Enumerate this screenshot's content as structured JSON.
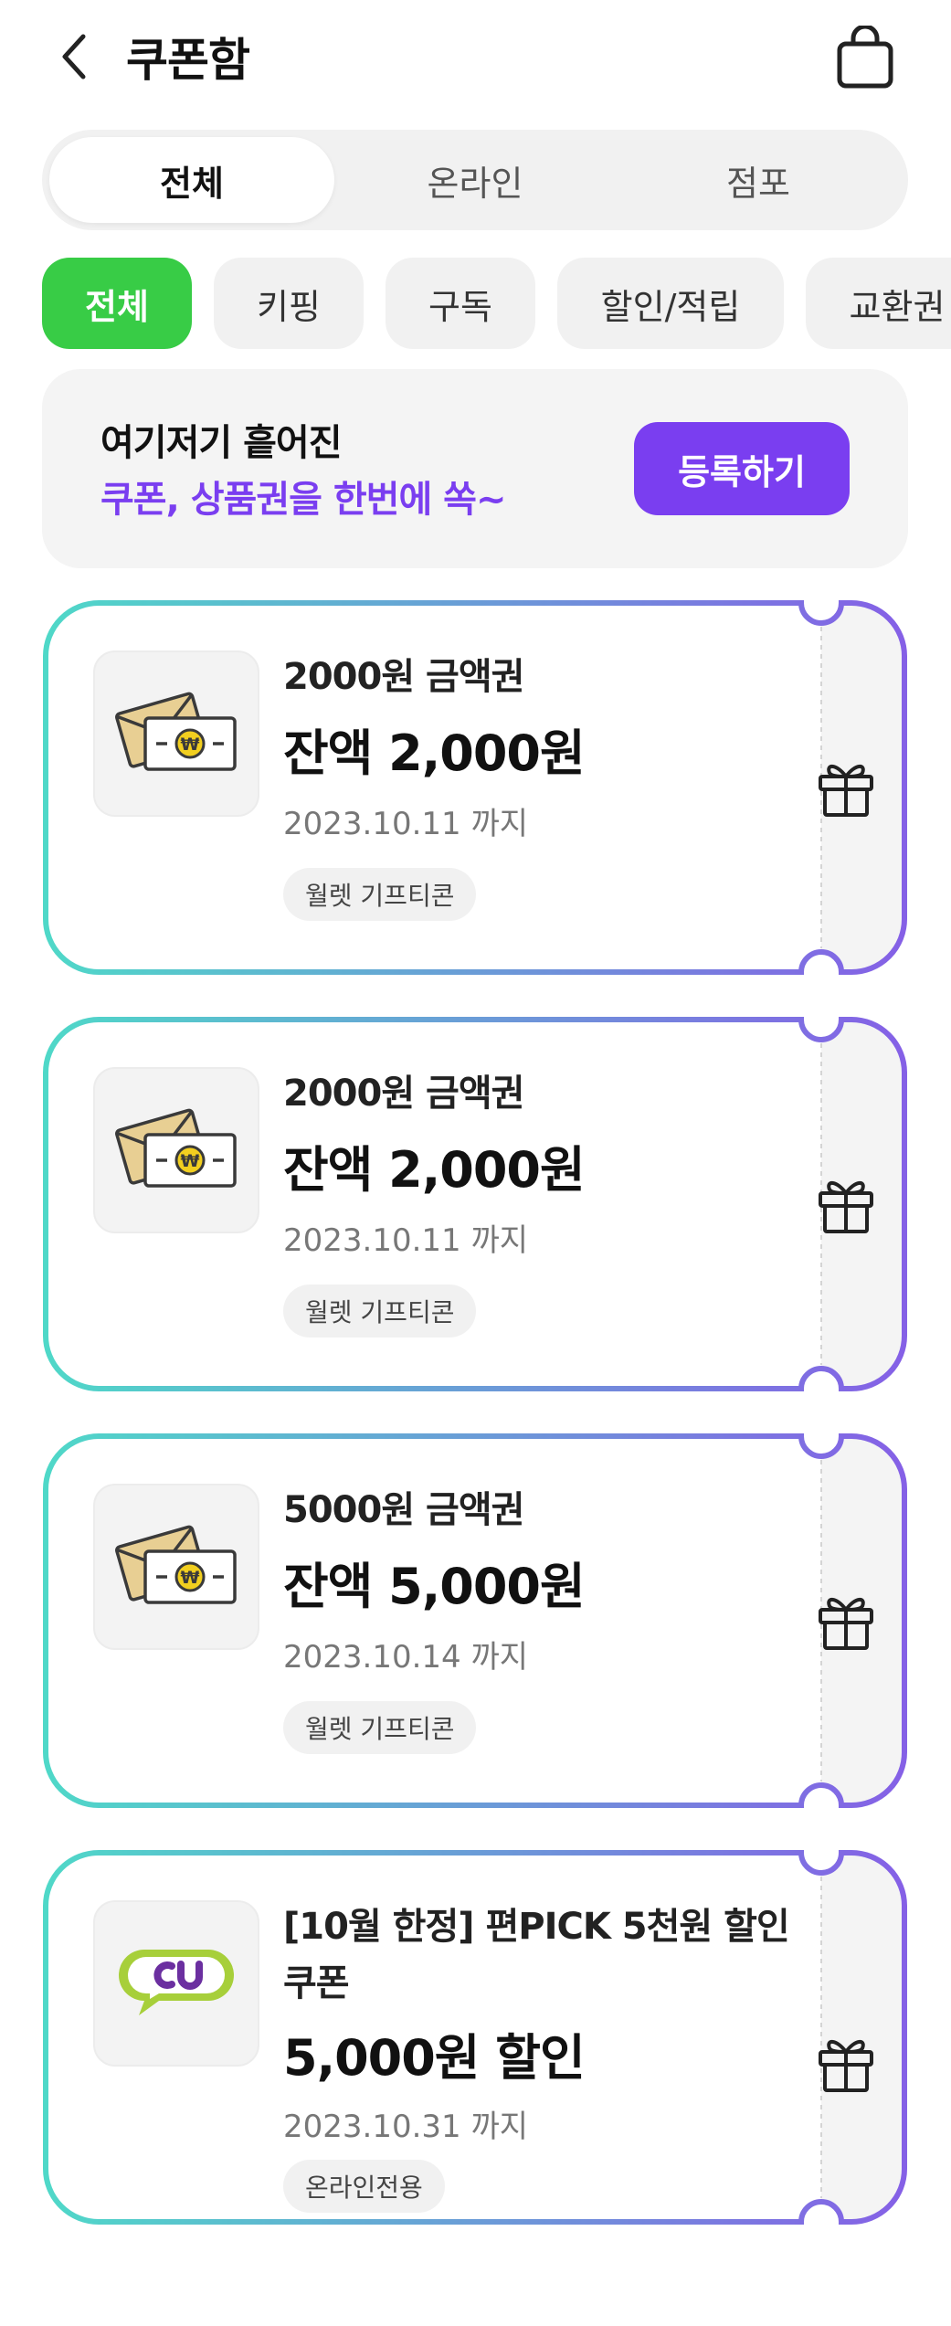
{
  "header": {
    "title": "쿠폰함",
    "back_icon": "chevron-left-icon",
    "bag_icon": "shopping-bag-icon"
  },
  "segments": [
    {
      "label": "전체",
      "active": true
    },
    {
      "label": "온라인",
      "active": false
    },
    {
      "label": "점포",
      "active": false
    }
  ],
  "chips": [
    {
      "label": "전체",
      "active": true
    },
    {
      "label": "키핑",
      "active": false
    },
    {
      "label": "구독",
      "active": false
    },
    {
      "label": "할인/적립",
      "active": false
    },
    {
      "label": "교환권",
      "active": false
    }
  ],
  "banner": {
    "line1": "여기저기 흩어진",
    "line2": "쿠폰, 상품권을 한번에 쏙~",
    "button": "등록하기"
  },
  "coupons": [
    {
      "name": "2000원 금액권",
      "amount": "잔액 2,000원",
      "expiry": "2023.10.11 까지",
      "tag": "월렛 기프티콘",
      "icon": "money-envelope-icon"
    },
    {
      "name": "2000원 금액권",
      "amount": "잔액 2,000원",
      "expiry": "2023.10.11 까지",
      "tag": "월렛 기프티콘",
      "icon": "money-envelope-icon"
    },
    {
      "name": "5000원 금액권",
      "amount": "잔액 5,000원",
      "expiry": "2023.10.14 까지",
      "tag": "월렛 기프티콘",
      "icon": "money-envelope-icon"
    },
    {
      "name": "[10월 한정] 편PICK 5천원 할인 쿠폰",
      "amount": "5,000원 할인",
      "expiry": "2023.10.31 까지",
      "tag": "온라인전용",
      "icon": "cu-logo-icon"
    }
  ],
  "colors": {
    "accent_purple": "#7a3ef0",
    "accent_green": "#38cc46",
    "gradient_start": "#4fd8c8",
    "gradient_end": "#8560e6"
  }
}
